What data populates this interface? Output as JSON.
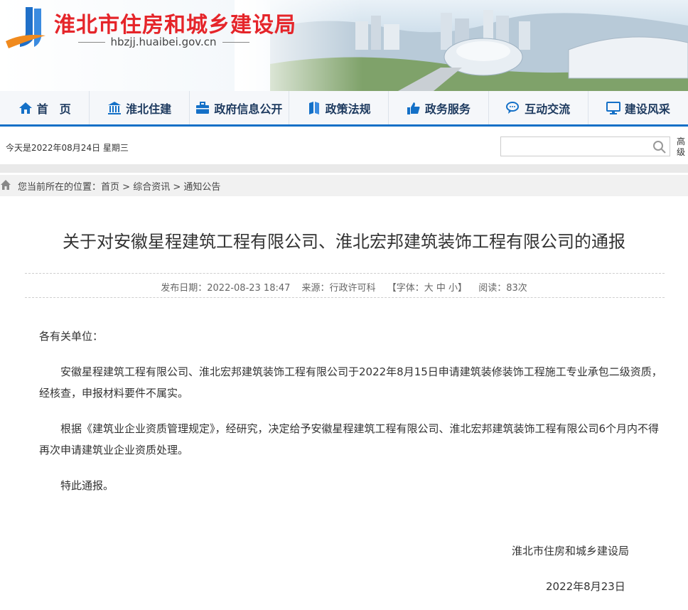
{
  "header": {
    "site_title": "淮北市住房和城乡建设局",
    "site_domain": "hbzjj.huaibei.gov.cn",
    "colors": {
      "title_red": "#e5252a",
      "logo_blue": "#1f6fc8",
      "logo_orange": "#f08a1e",
      "nav_blue": "#1470c7"
    }
  },
  "nav": {
    "items": [
      {
        "label": "首　页",
        "icon": "home-icon"
      },
      {
        "label": "淮北住建",
        "icon": "building-icon"
      },
      {
        "label": "政府信息公开",
        "icon": "briefcase-icon"
      },
      {
        "label": "政策法规",
        "icon": "book-icon"
      },
      {
        "label": "政务服务",
        "icon": "thumbs-up-icon"
      },
      {
        "label": "互动交流",
        "icon": "chat-icon"
      },
      {
        "label": "建设风采",
        "icon": "monitor-icon"
      }
    ]
  },
  "infobar": {
    "date_text": "今天是2022年08月24日 星期三",
    "search_placeholder": "",
    "advanced_search": "高级搜索"
  },
  "breadcrumb": {
    "prefix": "您当前所在的位置：",
    "items": [
      "首页",
      "综合资讯",
      "通知公告"
    ],
    "separator": " > "
  },
  "article": {
    "title": "关于对安徽星程建筑工程有限公司、淮北宏邦建筑装饰工程有限公司的通报",
    "meta": {
      "publish": "发布日期：2022-08-23 18:47",
      "source": "来源：行政许可科",
      "font_prefix": "【字体：",
      "font_large": "大",
      "font_medium": "中",
      "font_small": "小",
      "font_suffix": "】",
      "reads": "阅读：83次"
    },
    "salutation": "各有关单位：",
    "paragraphs": [
      "安徽星程建筑工程有限公司、淮北宏邦建筑装饰工程有限公司于2022年8月15日申请建筑装修装饰工程施工专业承包二级资质，经核查，申报材料要件不属实。",
      "根据《建筑业企业资质管理规定》，经研究，决定给予安徽星程建筑工程有限公司、淮北宏邦建筑装饰工程有限公司6个月内不得再次申请建筑业企业资质处理。",
      "特此通报。"
    ],
    "signature": "淮北市住房和城乡建设局",
    "sign_date": "2022年8月23日"
  }
}
